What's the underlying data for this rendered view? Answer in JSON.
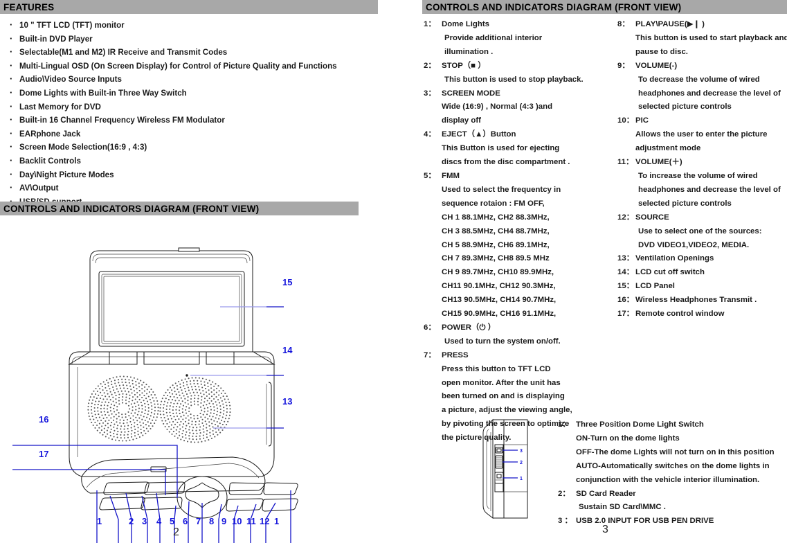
{
  "left_page": {
    "features_header": "FEATURES",
    "features": [
      "10 \" TFT LCD (TFT) monitor",
      "Built-in DVD Player",
      "Selectable(M1 and M2) IR Receive and Transmit Codes",
      "Multi-Lingual OSD (On Screen Display) for Control of Picture Quality and Functions",
      "Audio\\Video Source Inputs",
      "Dome Lights with Built-in Three Way Switch",
      "Last Memory for DVD",
      "Built-in 16 Channel Frequency Wireless FM Modulator",
      "EARphone Jack",
      "Screen Mode Selection(16:9 , 4:3)",
      "Backlit Controls",
      "Day\\Night Picture Modes",
      "AV\\Output",
      "USB/SD support"
    ],
    "diagram_header": "CONTROLS AND INDICATORS DIAGRAM (FRONT VIEW)",
    "callouts_right": [
      "15",
      "14",
      "13"
    ],
    "callouts_left": [
      "16",
      "17"
    ],
    "callouts_bottom": [
      "1",
      "2",
      "3",
      "4",
      "5",
      "6",
      "7",
      "8",
      "9",
      "10",
      "11",
      "12",
      "1"
    ],
    "page_number": "2"
  },
  "right_page": {
    "header": "CONTROLS AND INDICATORS DIAGRAM (FRONT VIEW)",
    "page_number": "3",
    "column_left": [
      {
        "num": "1：",
        "head": "Dome Lights",
        "indent": "ind1",
        "lines": [
          "Provide additional interior",
          "illumination ."
        ]
      },
      {
        "num": "2：",
        "head": "STOP（■ ）",
        "indent": "ind1",
        "lines": [
          "This button is used to stop playback."
        ]
      },
      {
        "num": "3：",
        "head": "SCREEN MODE",
        "indent": "ind2",
        "lines": [
          "Wide (16:9) , Normal (4:3 )and",
          "display off"
        ]
      },
      {
        "num": "4：",
        "head": "EJECT（▲）Button",
        "indent": "ind2",
        "lines": [
          "This Button is used for ejecting",
          "discs from the disc compartment ."
        ]
      },
      {
        "num": "5：",
        "head": "FMM",
        "indent": "ind2",
        "lines": [
          "Used to select the frequentcy in",
          "sequence rotaion : FM OFF,",
          "CH 1 88.1MHz,  CH2  88.3MHz,",
          "CH 3 88.5MHz,  CH4  88.7MHz,",
          "CH 5 88.9MHz,  CH6  89.1MHz,",
          "CH 7 89.3MHz,  CH8  89.5 MHz",
          "CH 9 89.7MHz,  CH10 89.9MHz,",
          "CH11 90.1MHz, CH12 90.3MHz,",
          "CH13 90.5MHz, CH14  90.7MHz,",
          "CH15 90.9MHz, CH16 91.1MHz,"
        ]
      },
      {
        "num": "6：",
        "head": "POWER（⏻ ）",
        "indent": "ind1",
        "lines": [
          "Used to turn the system on/off."
        ]
      },
      {
        "num": "7：",
        "head": "PRESS",
        "indent": "ind2",
        "lines": [
          "Press this button to TFT LCD",
          "open monitor. After the unit has",
          "been turned on and is displaying",
          "a picture, adjust the viewing angle,",
          "by pivoting the screen to optimize",
          "the picture quality."
        ]
      }
    ],
    "column_right": [
      {
        "num": "8：",
        "head": "PLAY\\PAUSE(▶❙ )",
        "indent": "ind2",
        "lines": [
          "This button is used to start playback and",
          "pause to disc."
        ]
      },
      {
        "num": "9：",
        "head": "VOLUME(-)",
        "indent": "ind1",
        "lines": [
          "To decrease the volume of wired",
          "headphones and decrease the level of",
          "selected picture controls"
        ]
      },
      {
        "num": "10：",
        "head": "PIC",
        "indent": "ind2",
        "lines": [
          "Allows the user to enter the picture",
          "adjustment mode"
        ]
      },
      {
        "num": "11：",
        "head": "VOLUME(＋)",
        "indent": "ind1",
        "lines": [
          "To increase the volume of wired",
          "headphones and decrease the level of",
          "selected  picture controls"
        ]
      },
      {
        "num": "12：",
        "head": "SOURCE",
        "indent": "ind1",
        "lines": [
          "Use to select one of the sources:",
          "DVD VIDEO1,VIDEO2, MEDIA."
        ]
      },
      {
        "num": "13：",
        "head": "Ventilation Openings",
        "indent": "ind2",
        "lines": []
      },
      {
        "num": "14：",
        "head": "LCD   cut off switch",
        "indent": "ind2",
        "lines": []
      },
      {
        "num": "15：",
        "head": "LCD   Panel",
        "indent": "ind2",
        "lines": []
      },
      {
        "num": "16：",
        "head": "Wireless Headphones Transmit .",
        "indent": "ind2",
        "lines": []
      },
      {
        "num": "17：",
        "head": "Remote control window",
        "indent": "ind2",
        "lines": []
      }
    ],
    "side_view": {
      "callouts": [
        "3",
        "2",
        "1"
      ],
      "entries": [
        {
          "num": "1：",
          "head": "Three Position Dome Light Switch",
          "indent": "ind2",
          "lines": [
            "ON-Turn on the dome lights",
            "OFF-The dome Lights will not turn on in this position",
            "AUTO-Automatically switches on the dome lights in",
            "conjunction with the vehicle interior illumination."
          ]
        },
        {
          "num": "2：",
          "head": "SD Card Reader",
          "indent": "ind1",
          "lines": [
            "Sustain SD Card\\MMC  ."
          ]
        },
        {
          "num": "3 ：",
          "head": "USB 2.0   INPUT FOR USB PEN DRIVE",
          "indent": "ind2",
          "lines": []
        }
      ]
    }
  },
  "colors": {
    "header_bar": "#a8a8a8",
    "callout_text": "#1414dc",
    "leader_line": "#9a9aec",
    "leader_line_dark": "#1414c8",
    "ink": "#1a1a1a"
  }
}
